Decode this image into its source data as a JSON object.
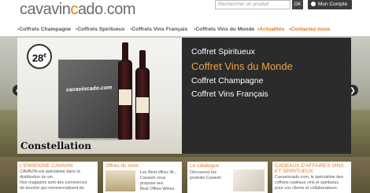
{
  "header": {
    "logo": {
      "part1": "cavavin",
      "accent": "c",
      "part2": "ado",
      "dot": ".",
      "tld": "com"
    },
    "search_placeholder": "Rechercher un produit",
    "search_button": "OK",
    "account_button": "Mon Compte"
  },
  "nav": {
    "items": [
      {
        "label": "Coffrets Champagne",
        "highlight": false
      },
      {
        "label": "Coffrets Spiritueux",
        "highlight": false
      },
      {
        "label": "Coffrets Vins Français",
        "highlight": false
      },
      {
        "label": "Coffrets Vins du Monde",
        "highlight": false
      },
      {
        "label": "Actualités",
        "highlight": true
      },
      {
        "label": "Contactez-nous",
        "highlight": true
      }
    ]
  },
  "slider": {
    "price": "28",
    "currency": "€",
    "caption": "Constellation",
    "box_label": "cavavincado.com",
    "bottle1_label": "CHAKANA",
    "bottle2_label": "CHAKANA",
    "menu": [
      {
        "label": "Coffret Spiritueux",
        "active": false
      },
      {
        "label": "Coffret Vins du Monde",
        "active": true
      },
      {
        "label": "Coffret Champagne",
        "active": false
      },
      {
        "label": "Coffret Vins Français",
        "active": false
      }
    ],
    "prev_icon": "chevron-left-icon",
    "next_icon": "chevron-right-icon"
  },
  "cards": [
    {
      "title": "L'ENSEIGNE CAVAVIN",
      "text": [
        "CAVAVIN est spécialiste dans la",
        "distribution du vin.",
        "Nos magasins sont des commerces",
        "de bouche qui commercialisent du"
      ]
    },
    {
      "title": "Offres du mois",
      "text": [
        "Les Best offres W...",
        "Cavavin vous",
        "propose ses",
        "Best Offres Wines."
      ]
    },
    {
      "title": "Le catalogue",
      "text": [
        "Découvrez les",
        "produits Cavavin"
      ]
    },
    {
      "title": "CADEAUX D'AFFAIRES VINS ET SPIRITUEUX",
      "text": [
        "Cavavincado.com, le spécialiste des",
        "coffrets cadeaux vins et spiritueux",
        "pour vos clients et collaborateurs."
      ]
    }
  ],
  "colors": {
    "accent": "#e07a1f",
    "dark_panel": "#2b2b2b",
    "active_menu": "#f0a040"
  }
}
